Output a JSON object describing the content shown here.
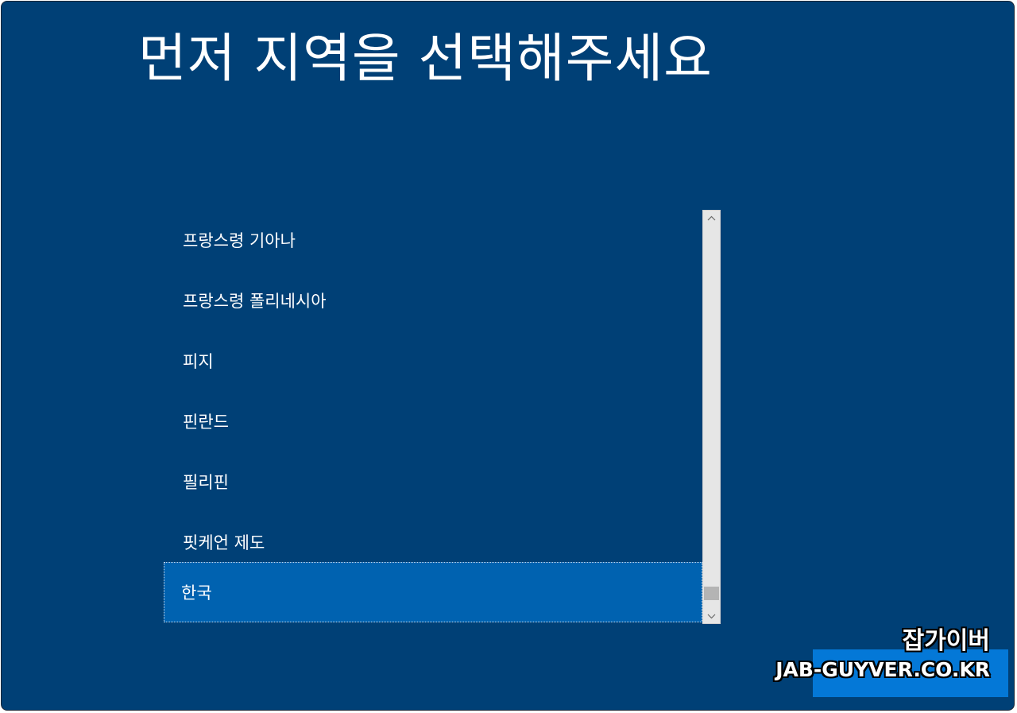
{
  "page": {
    "title": "먼저 지역을 선택해주세요"
  },
  "region_list": {
    "items": [
      {
        "label": "프랑스령 기아나",
        "selected": false
      },
      {
        "label": "프랑스령 폴리네시아",
        "selected": false
      },
      {
        "label": "피지",
        "selected": false
      },
      {
        "label": "핀란드",
        "selected": false
      },
      {
        "label": "필리핀",
        "selected": false
      },
      {
        "label": "핏케언 제도",
        "selected": false
      },
      {
        "label": "한국",
        "selected": true
      }
    ],
    "scroll_position_fraction": 0.95
  },
  "footer": {
    "next_label": ""
  },
  "watermark": {
    "line1": "잡가이버",
    "line2": "JAB-GUYVER.CO.KR"
  },
  "colors": {
    "background": "#004076",
    "selected_item": "#0062b0",
    "primary_button": "#0478d7",
    "scrollbar_track": "#e6e6e6"
  },
  "icons": {
    "scroll_up": "chevron-up-icon",
    "scroll_down": "chevron-down-icon"
  }
}
